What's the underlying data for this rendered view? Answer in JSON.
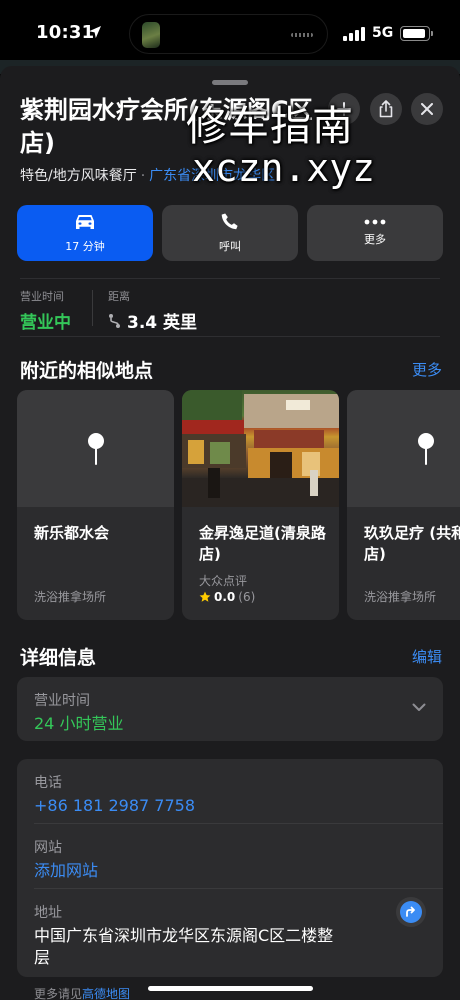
{
  "status_bar": {
    "time": "10:31",
    "network": "5G"
  },
  "place": {
    "title": "紫荆园水疗会所(东源阁C区店)",
    "category": "特色/地方风味餐厅",
    "separator": "·",
    "region_link": "广东省深圳市龙华区"
  },
  "watermark": {
    "line1": "修车指南",
    "line2": "xczn.xyz"
  },
  "actions": [
    {
      "label": "17 分钟",
      "icon": "car-icon"
    },
    {
      "label": "呼叫",
      "icon": "phone-icon"
    },
    {
      "label": "更多",
      "icon": "more-icon"
    }
  ],
  "info": {
    "hours_label": "营业时间",
    "hours_value": "营业中",
    "distance_label": "距离",
    "distance_value": "3.4 英里"
  },
  "nearby": {
    "title": "附近的相似地点",
    "more": "更多",
    "cards": [
      {
        "name": "新乐都水会",
        "category": "洗浴推拿场所",
        "image": "pin-icon"
      },
      {
        "name": "金昇逸足道(清泉路店)",
        "source": "大众点评",
        "rating": "0.0",
        "reviews": "(6)",
        "image": "storefront-photo"
      },
      {
        "name": "玖玖足疗 (共和花园店)",
        "category": "洗浴推拿场所",
        "image": "pin-icon"
      }
    ]
  },
  "details": {
    "title": "详细信息",
    "edit": "编辑",
    "hours_label": "营业时间",
    "hours_value": "24 小时营业",
    "phone_label": "电话",
    "phone_value": "+86 181 2987 7758",
    "website_label": "网站",
    "website_value": "添加网站",
    "address_label": "地址",
    "address_value": "中国广东省深圳市龙华区东源阁C区二楼整层"
  },
  "footer": {
    "prefix": "更多请见",
    "link": "高德地图"
  },
  "colors": {
    "accent": "#0a5cf2",
    "link": "#3b8cf4",
    "open": "#34c759",
    "rating_star": "#ffcc00"
  }
}
